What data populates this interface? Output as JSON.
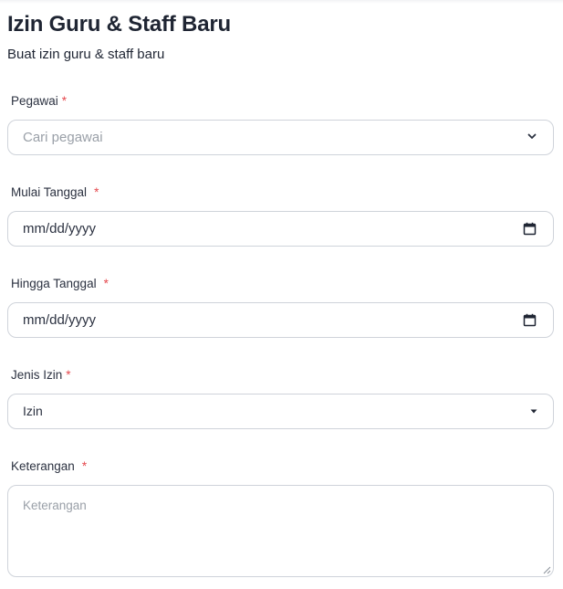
{
  "header": {
    "title": "Izin Guru & Staff Baru",
    "subtitle": "Buat izin guru & staff baru"
  },
  "form": {
    "required_mark": "*",
    "employee": {
      "label": "Pegawai",
      "placeholder": "Cari pegawai",
      "icon": "chevron-down-icon"
    },
    "start_date": {
      "label": "Mulai Tanggal",
      "placeholder": "mm/dd/yyyy",
      "icon": "calendar-icon"
    },
    "end_date": {
      "label": "Hingga Tanggal",
      "placeholder": "mm/dd/yyyy",
      "icon": "calendar-icon"
    },
    "leave_type": {
      "label": "Jenis Izin",
      "selected": "Izin",
      "icon": "caret-down-icon"
    },
    "notes": {
      "label": "Keterangan",
      "placeholder": "Keterangan"
    }
  },
  "colors": {
    "required": "#e5484d",
    "border": "#cfd3da",
    "placeholder": "#9aa0a8",
    "text": "#1f2533"
  }
}
